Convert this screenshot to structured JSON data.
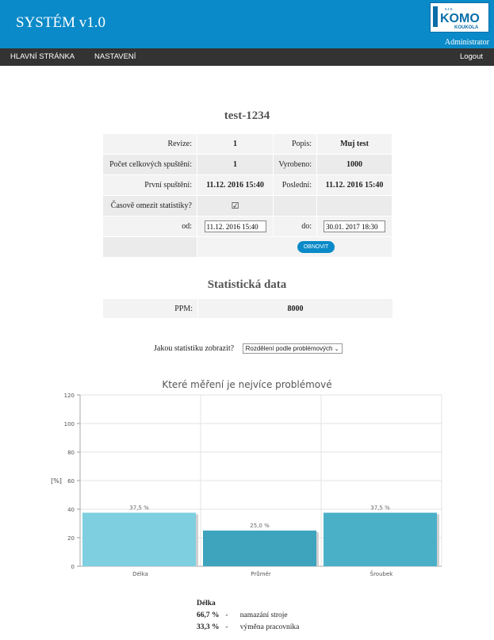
{
  "header": {
    "title": "SYSTÉM v1.0",
    "logo_text": "KOMO",
    "logo_subtext": "KOUKOLA",
    "logo_small": "s.r.o.",
    "user": "Administrator"
  },
  "nav": {
    "home": "HLAVNÍ STRÁNKA",
    "settings": "NASTAVENÍ",
    "logout": "Logout"
  },
  "page_title": "test-1234",
  "info": {
    "revize_label": "Revize:",
    "revize_value": "1",
    "popis_label": "Popis:",
    "popis_value": "Muj test",
    "pocet_label": "Počet celkových spuštění:",
    "pocet_value": "1",
    "vyrobeno_label": "Vyrobeno:",
    "vyrobeno_value": "1000",
    "prvni_label": "První spuštění:",
    "prvni_value": "11.12. 2016 15:40",
    "posledni_label": "Poslední:",
    "posledni_value": "11.12. 2016 15:40",
    "omezit_label": "Časově omezit statistiky?",
    "omezit_checked": "☑",
    "od_label": "od:",
    "od_value": "11.12. 2016 15:40",
    "do_label": "do:",
    "do_value": "30.01. 2017 18:30",
    "refresh_label": "OBNOVIT"
  },
  "stats": {
    "title": "Statistická data",
    "ppm_label": "PPM:",
    "ppm_value": "8000"
  },
  "selector": {
    "label": "Jakou statistiku zobrazit?",
    "selected": "Rozdělení podle problémových"
  },
  "chart_data": {
    "type": "bar",
    "title": "Které měření je nejvíce problémové",
    "xlabel": "",
    "ylabel": "[%]",
    "ylim": [
      0,
      120
    ],
    "yticks": [
      0,
      20,
      40,
      60,
      80,
      100,
      120
    ],
    "grid": true,
    "categories": [
      "Délka",
      "Průměr",
      "Šroubek"
    ],
    "values": [
      37.5,
      25.0,
      37.5
    ],
    "value_labels": [
      "37,5 %",
      "25,0 %",
      "37,5 %"
    ],
    "colors": [
      "#7ecfe0",
      "#3ea3bd",
      "#4ab0c8"
    ]
  },
  "details": {
    "title": "Délka",
    "items": [
      {
        "percent": "66,7 %",
        "sep": "-",
        "text": "namazání stroje"
      },
      {
        "percent": "33,3 %",
        "sep": "-",
        "text": "výměna pracovníka"
      }
    ]
  }
}
